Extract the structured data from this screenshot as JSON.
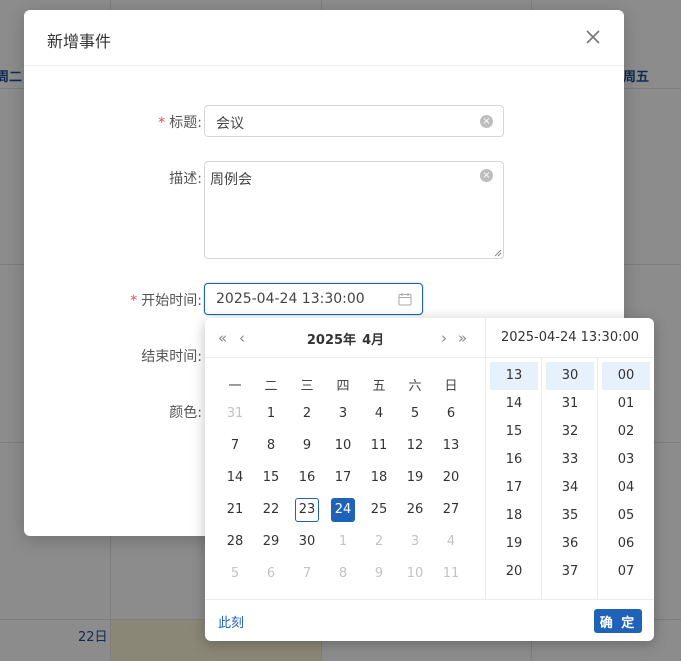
{
  "background": {
    "weekday_headers": [
      "周二",
      "周五"
    ],
    "day_label": "22日"
  },
  "dialog": {
    "title": "新增事件",
    "close_icon": "close-icon",
    "fields": {
      "title": {
        "label": "标题:",
        "required": true,
        "value": "会议"
      },
      "description": {
        "label": "描述:",
        "required": false,
        "value": "周例会"
      },
      "start": {
        "label": "开始时间:",
        "required": true,
        "value": "2025-04-24 13:30:00"
      },
      "end": {
        "label": "结束时间:",
        "required": false
      },
      "color": {
        "label": "颜色:",
        "required": false
      }
    },
    "required_mark": "*"
  },
  "picker": {
    "year": "2025年",
    "month": "4月",
    "weekdays": [
      "一",
      "二",
      "三",
      "四",
      "五",
      "六",
      "日"
    ],
    "days": [
      [
        "31",
        "1",
        "2",
        "3",
        "4",
        "5",
        "6"
      ],
      [
        "7",
        "8",
        "9",
        "10",
        "11",
        "12",
        "13"
      ],
      [
        "14",
        "15",
        "16",
        "17",
        "18",
        "19",
        "20"
      ],
      [
        "21",
        "22",
        "23",
        "24",
        "25",
        "26",
        "27"
      ],
      [
        "28",
        "29",
        "30",
        "1",
        "2",
        "3",
        "4"
      ],
      [
        "5",
        "6",
        "7",
        "8",
        "9",
        "10",
        "11"
      ]
    ],
    "selected_datetime": "2025-04-24 13:30:00",
    "hours": [
      "13",
      "14",
      "15",
      "16",
      "17",
      "18",
      "19",
      "20"
    ],
    "minutes": [
      "30",
      "31",
      "32",
      "33",
      "34",
      "35",
      "36",
      "37"
    ],
    "seconds": [
      "00",
      "01",
      "02",
      "03",
      "04",
      "05",
      "06",
      "07"
    ],
    "now_label": "此刻",
    "ok_label": "确 定",
    "accent_color": "#1e63b8"
  }
}
